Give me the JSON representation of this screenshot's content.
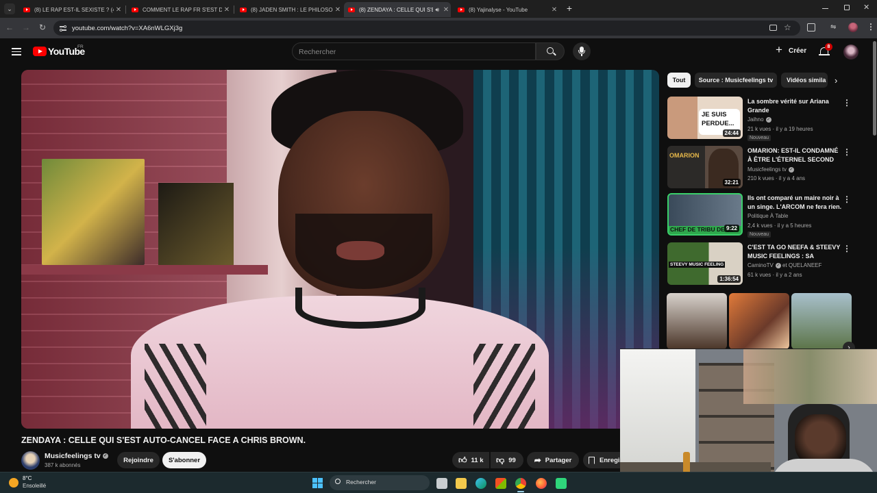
{
  "browser": {
    "tabs": [
      {
        "title": "(8) LE RAP EST-IL SEXISTE ? (4 F",
        "active": false
      },
      {
        "title": "COMMENT LE RAP FR S'EST DÉ",
        "active": false
      },
      {
        "title": "(8) JADEN SMITH : LE PHILOSO",
        "active": false
      },
      {
        "title": "(8) ZENDAYA : CELLE QUI S'E",
        "active": true
      },
      {
        "title": "(8) Yajinalyse - YouTube",
        "active": false
      }
    ],
    "new_tab_symbol": "+",
    "url": "youtube.com/watch?v=XA6nWLGXj3g"
  },
  "youtube": {
    "logo_text": "YouTube",
    "region": "FR",
    "search_placeholder": "Rechercher",
    "create_label": "Créer",
    "notification_count": "8"
  },
  "video": {
    "title": "ZENDAYA : CELLE QUI S'EST AUTO-CANCEL FACE A CHRIS BROWN.",
    "channel_name": "Musicfeelings tv",
    "subscribers": "387 k abonnés",
    "join_label": "Rejoindre",
    "subscribe_label": "S'abonner",
    "likes": "11 k",
    "dislikes": "99",
    "share_label": "Partager",
    "save_label": "Enregis"
  },
  "chips": [
    "Tout",
    "Source : Musicfeelings tv",
    "Vidéos simila"
  ],
  "recommendations": [
    {
      "title": "La sombre vérité sur Ariana Grande",
      "channel": "Jaihno",
      "verified": true,
      "meta": "21 k vues · il y a 19 heures",
      "badge": "Nouveau",
      "duration": "24:44",
      "thumb_text": "JE SUIS PERDUE..."
    },
    {
      "title": "OMARION: EST-IL CONDAMNÉ À ÊTRE L'ÉTERNEL SECOND D...",
      "channel": "Musicfeelings tv",
      "verified": true,
      "meta": "210 k vues · il y a 4 ans",
      "badge": "",
      "duration": "32:21",
      "thumb_text": "OMARION"
    },
    {
      "title": "Ils ont comparé un maire noir à un singe. L'ARCOM ne fera rien.",
      "channel": "Politique À Table",
      "verified": false,
      "meta": "2,4 k vues · il y a 5 heures",
      "badge": "Nouveau",
      "duration": "9:22",
      "thumb_text": "CHEF DE TRIBU DE SII"
    },
    {
      "title": "C'EST TA GO NEEFA & STEEVY MUSIC FEELINGS : SA CULTUR...",
      "channel": "CaminoTV",
      "channel_suffix": "et QUELANEEF",
      "verified": true,
      "meta": "61 k vues · il y a 2 ans",
      "badge": "",
      "duration": "1:36:54",
      "thumb_text": "STEEVY MUSIC FEELING"
    }
  ],
  "taskbar": {
    "temperature": "8°C",
    "weather": "Ensoleillé",
    "search_placeholder": "Rechercher"
  },
  "colors": {
    "youtube_red": "#ff0000",
    "background": "#0f0f0f",
    "chip_active": "#f1f1f1",
    "chip_inactive": "#272727"
  }
}
